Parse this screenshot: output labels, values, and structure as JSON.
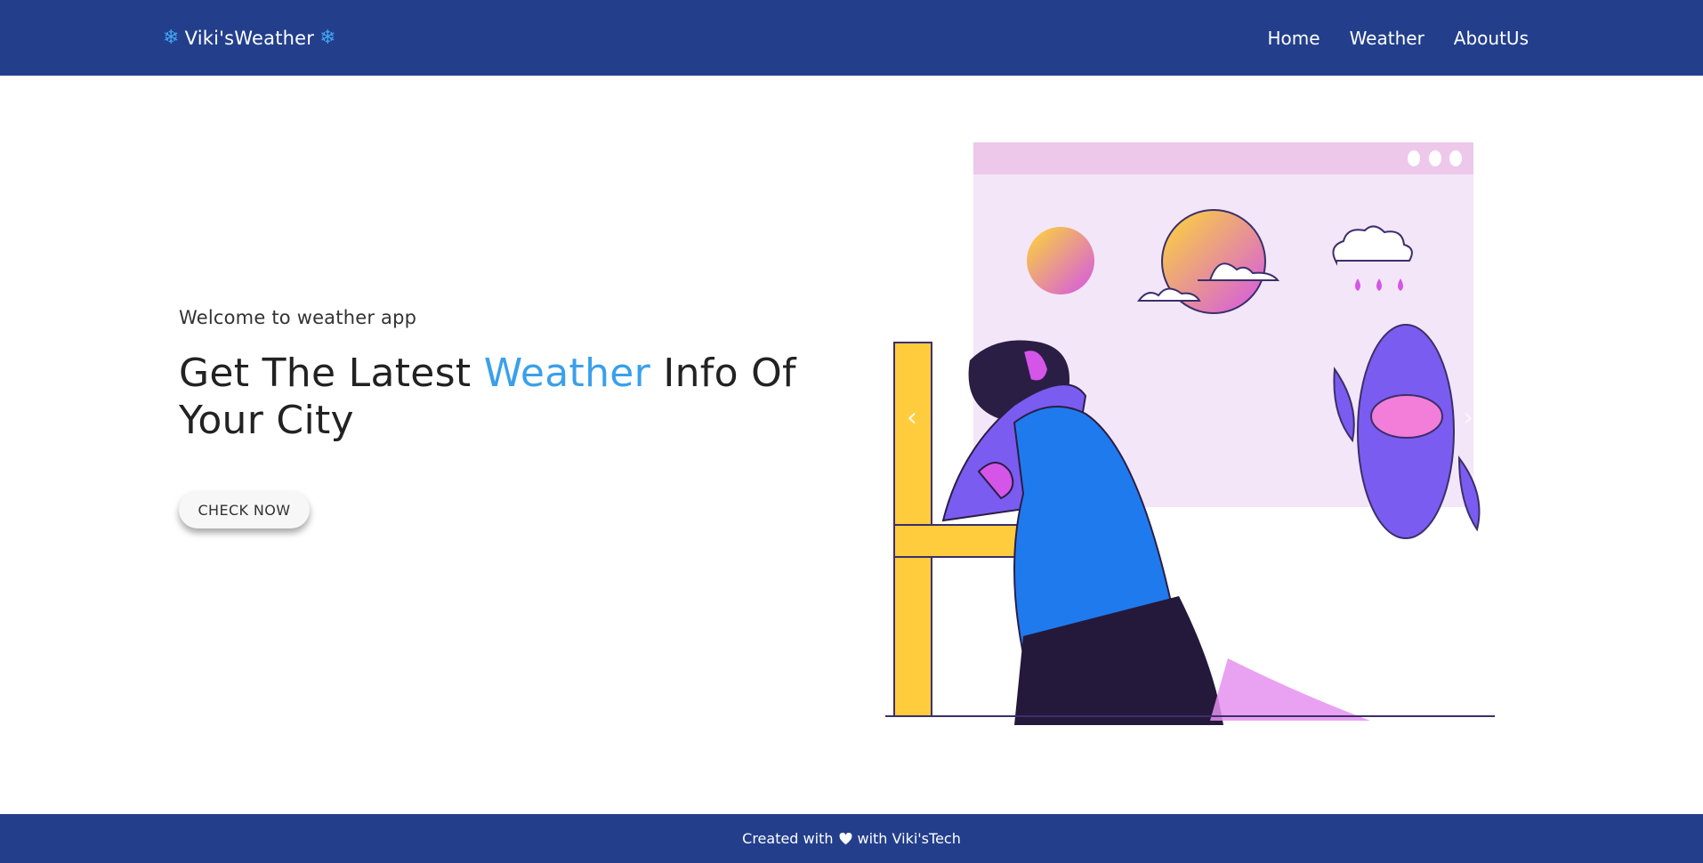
{
  "navbar": {
    "brand": "Viki'sWeather",
    "brand_icon": "snowflake-icon",
    "brand_icon_color": "#42a5f5",
    "background": "#233f8c",
    "links": [
      "Home",
      "Weather",
      "AboutUs"
    ]
  },
  "hero": {
    "welcome": "Welcome to weather app",
    "headline_before": "Get The Latest ",
    "headline_accent": "Weather",
    "headline_after": " Info Of Your City",
    "accent_color": "#3aa0ea",
    "cta_label": "CHECK NOW"
  },
  "footer": {
    "text_before": "Created with",
    "text_after": "with Viki'sTech",
    "icon": "heart-icon"
  }
}
